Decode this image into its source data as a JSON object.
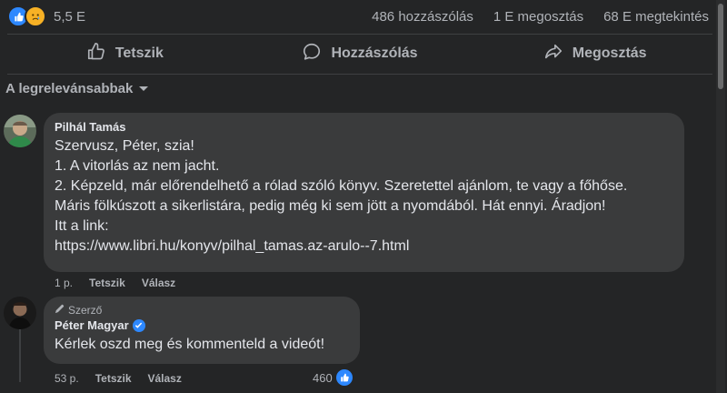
{
  "stats": {
    "reaction_count": "5,5 E",
    "comments": "486 hozzászólás",
    "shares": "1 E megosztás",
    "views": "68 E megtekintés"
  },
  "actions": {
    "like": "Tetszik",
    "comment": "Hozzászólás",
    "share": "Megosztás"
  },
  "sort_label": "A legrelevánsabbak",
  "comments": [
    {
      "author": "Pilhál Tamás",
      "lines": [
        "Szervusz, Péter, szia!",
        "1. A vitorlás az nem jacht.",
        "2. Képzeld, már előrendelhető a rólad szóló könyv. Szeretettel ajánlom, te vagy a főhőse.",
        "Máris fölkúszott a sikerlistára, pedig még ki sem jött a nyomdából. Hát ennyi. Áradjon!",
        "Itt a link:",
        "https://www.libri.hu/konyv/pilhal_tamas.az-arulo--7.html"
      ],
      "time": "1 p.",
      "like": "Tetszik",
      "reply": "Válasz"
    },
    {
      "badge": "Szerző",
      "author": "Péter Magyar",
      "lines": [
        "Kérlek oszd meg és kommenteld a videót!"
      ],
      "time": "53 p.",
      "like": "Tetszik",
      "reply": "Válasz",
      "likes": "460"
    }
  ],
  "colors": {
    "background": "#242526",
    "bubble": "#3a3b3c",
    "accent": "#2d88ff"
  }
}
